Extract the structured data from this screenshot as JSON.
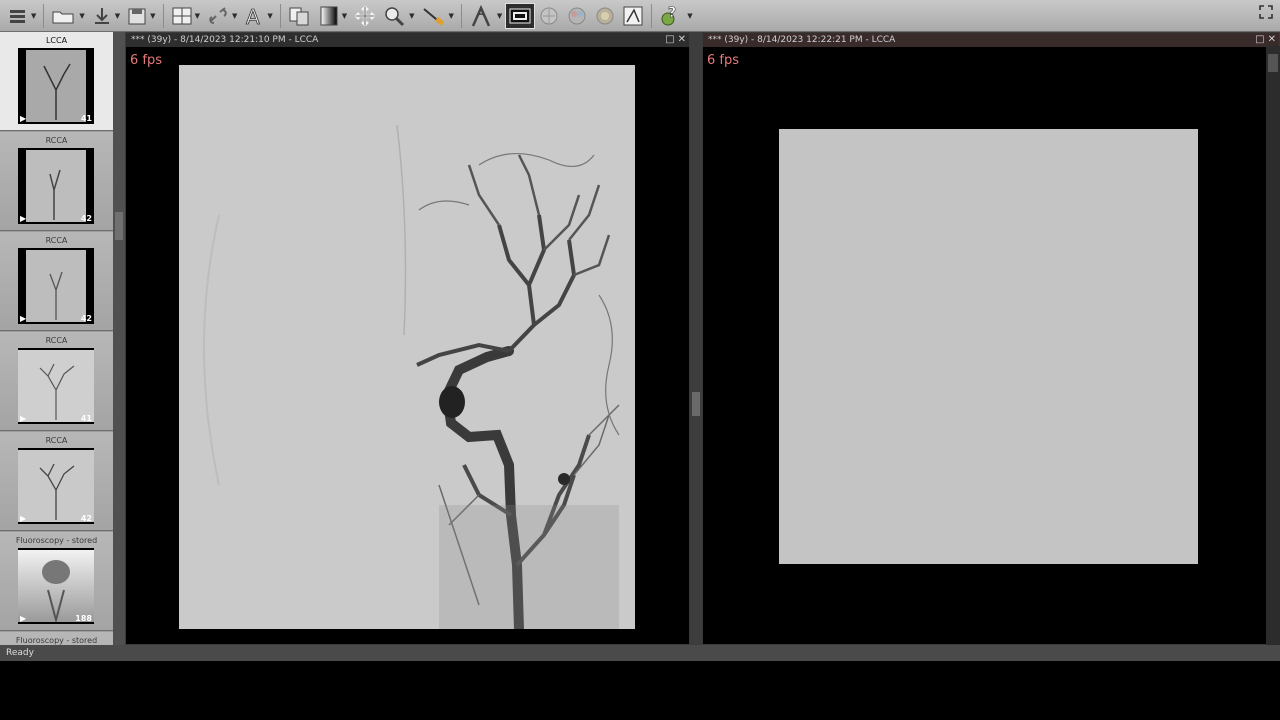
{
  "toolbar": {
    "icons": [
      "menu-icon",
      "open-folder-icon",
      "download-icon",
      "save-icon",
      "layout-grid-icon",
      "link-icon",
      "text-annotation-icon",
      "copy-pages-icon",
      "window-level-icon",
      "pan-icon",
      "zoom-icon",
      "measure-icon",
      "angle-icon",
      "cine-icon",
      "3d-icon",
      "color-icon",
      "fusion-icon",
      "edit-icon",
      "help-icon"
    ]
  },
  "thumbnails": [
    {
      "label": "LCCA",
      "count": "41",
      "selected": true
    },
    {
      "label": "RCCA",
      "count": "42",
      "selected": false
    },
    {
      "label": "RCCA",
      "count": "42",
      "selected": false
    },
    {
      "label": "RCCA",
      "count": "41",
      "selected": false
    },
    {
      "label": "RCCA",
      "count": "42",
      "selected": false
    },
    {
      "label": "Fluoroscopy - stored",
      "count": "188",
      "selected": false
    },
    {
      "label": "Fluoroscopy - stored",
      "count": "",
      "selected": false
    }
  ],
  "viewport_left": {
    "title": "*** (39y) - 8/14/2023 12:21:10 PM - LCCA",
    "fps": "6 fps"
  },
  "viewport_right": {
    "title": "*** (39y) - 8/14/2023 12:22:21 PM - LCCA",
    "fps": "6 fps"
  },
  "status": {
    "text": "Ready"
  }
}
